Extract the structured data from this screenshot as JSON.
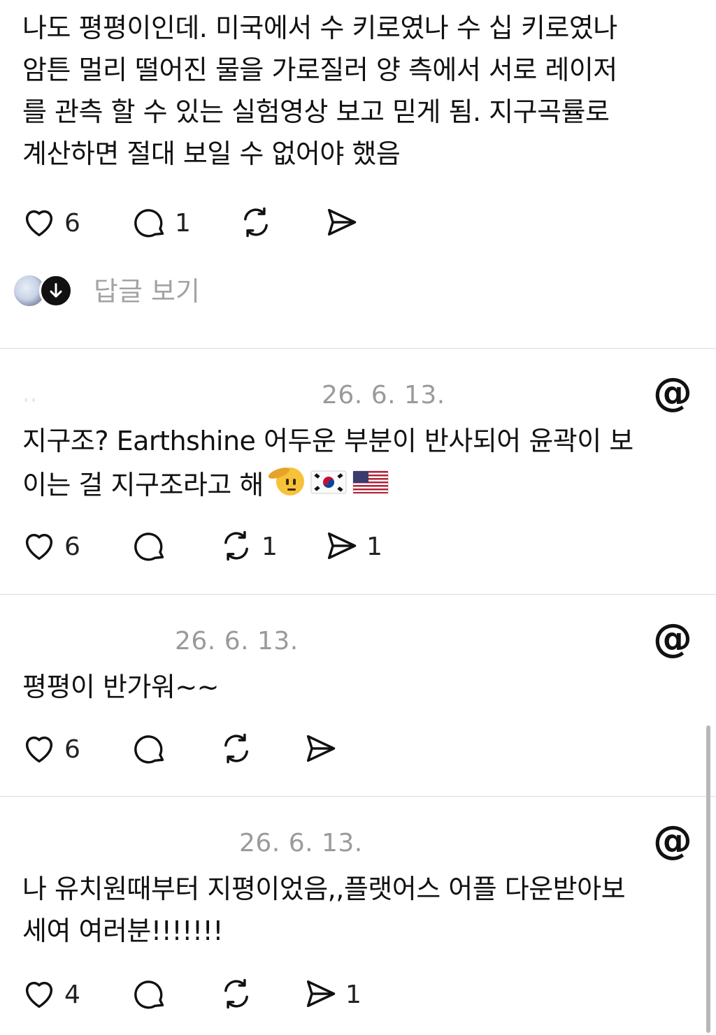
{
  "posts": [
    {
      "text": "나도 평평이인데. 미국에서 수 키로였나 수 십 키로였나\n암튼 멀리 떨어진 물을 가로질러 양 측에서 서로 레이저\n를 관측 할 수 있는 실험영상 보고 믿게 됨. 지구곡률로\n계산하면 절대 보일 수 없어야 했음",
      "likes": "6",
      "comments": "1",
      "reposts": "",
      "shares": "",
      "view_replies_label": "답글 보기"
    },
    {
      "author": "··",
      "date": "26. 6. 13.",
      "text": "지구조? Earthshine 어두운 부분이 반사되어 윤곽이 보\n이는 걸 지구조라고 해",
      "likes": "6",
      "comments": "",
      "reposts": "1",
      "shares": "1"
    },
    {
      "author": "",
      "date": "26. 6. 13.",
      "text": "평평이 반가워~~",
      "likes": "6",
      "comments": "",
      "reposts": "",
      "shares": ""
    },
    {
      "author": "",
      "date": "26. 6. 13.",
      "text": "나 유치원때부터 지평이었음,,플랫어스 어플 다운받아보\n세여 여러분!!!!!!!",
      "likes": "4",
      "comments": "",
      "reposts": "",
      "shares": "1"
    }
  ],
  "icons": {
    "like": "heart-icon",
    "comment": "speech-bubble-icon",
    "repost": "repost-arrows-icon",
    "share": "paper-plane-icon",
    "app": "threads-logo-icon",
    "expand": "arrow-down-icon"
  },
  "colors": {
    "text": "#111111",
    "muted": "#9a9a9a",
    "divider": "#dcdcdc",
    "background": "#ffffff"
  }
}
